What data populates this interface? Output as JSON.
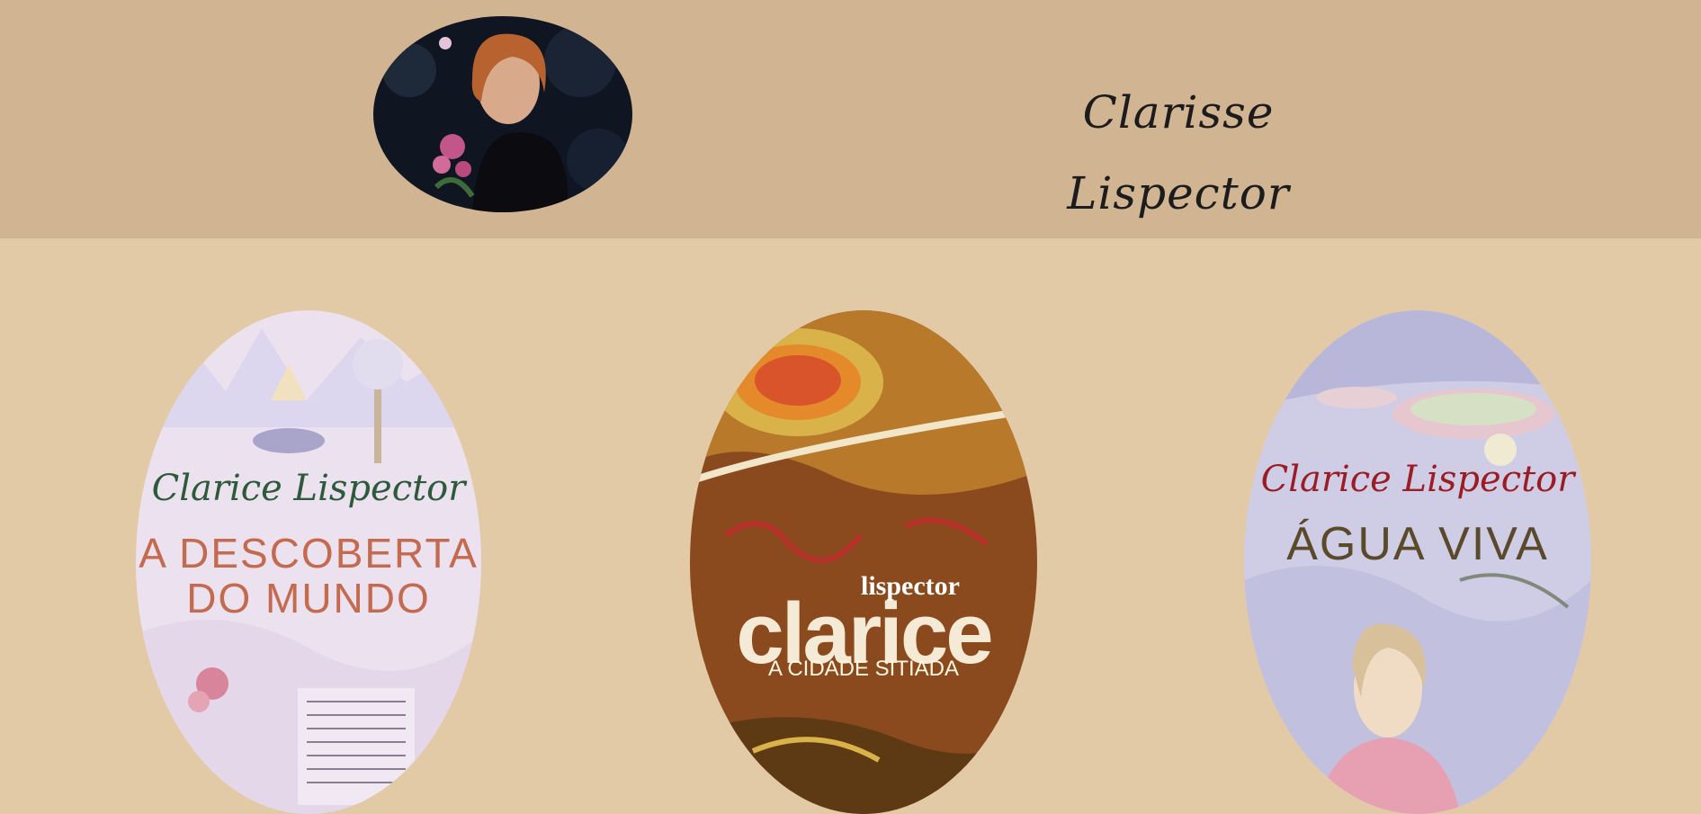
{
  "header": {
    "author_name": "Clarisse Lispector"
  },
  "books": [
    {
      "author": "Clarice Lispector",
      "title_line1": "A DESCOBERTA",
      "title_line2": "DO MUNDO"
    },
    {
      "author_first": "clarice",
      "author_last": "lispector",
      "title": "A CIDADE SITIADA"
    },
    {
      "author": "Clarice Lispector",
      "title": "ÁGUA VIVA"
    }
  ],
  "colors": {
    "page_background": "#e3caa7",
    "header_background": "#d1b592"
  }
}
